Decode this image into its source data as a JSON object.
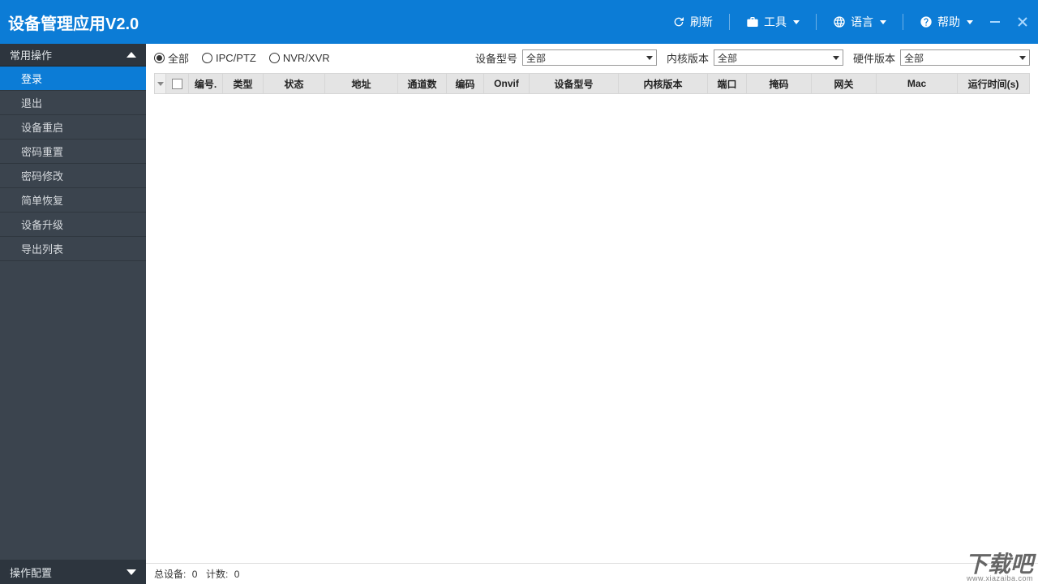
{
  "app": {
    "title": "设备管理应用V2.0"
  },
  "titlebar": {
    "refresh": "刷新",
    "tools": "工具",
    "language": "语言",
    "help": "帮助"
  },
  "sidebar": {
    "section_common": "常用操作",
    "section_config": "操作配置",
    "items": [
      {
        "label": "登录",
        "active": true
      },
      {
        "label": "退出"
      },
      {
        "label": "设备重启"
      },
      {
        "label": "密码重置"
      },
      {
        "label": "密码修改"
      },
      {
        "label": "简单恢复"
      },
      {
        "label": "设备升级"
      },
      {
        "label": "导出列表"
      }
    ]
  },
  "filters": {
    "radios": {
      "all": "全部",
      "ipc": "IPC/PTZ",
      "nvr": "NVR/XVR",
      "selected": "all"
    },
    "device_type_label": "设备型号",
    "device_type_value": "全部",
    "kernel_label": "内核版本",
    "kernel_value": "全部",
    "hw_label": "硬件版本",
    "hw_value": "全部"
  },
  "table": {
    "headers": {
      "no": "编号.",
      "type": "类型",
      "status": "状态",
      "address": "地址",
      "channels": "通道数",
      "encode": "编码",
      "onvif": "Onvif",
      "model": "设备型号",
      "kernel": "内核版本",
      "port": "端口",
      "mask": "掩码",
      "gateway": "网关",
      "mac": "Mac",
      "uptime": "运行时间(s)"
    },
    "col_widths": {
      "no": 42,
      "type": 50,
      "status": 76,
      "address": 90,
      "channels": 60,
      "encode": 46,
      "onvif": 56,
      "model": 110,
      "kernel": 110,
      "port": 48,
      "mask": 80,
      "gateway": 80,
      "mac": 100,
      "uptime": 98
    }
  },
  "status": {
    "total_label": "总设备:",
    "total_value": "0",
    "count_label": "计数:",
    "count_value": "0"
  },
  "watermark": {
    "text": "下载吧",
    "url": "www.xiazaiba.com"
  }
}
